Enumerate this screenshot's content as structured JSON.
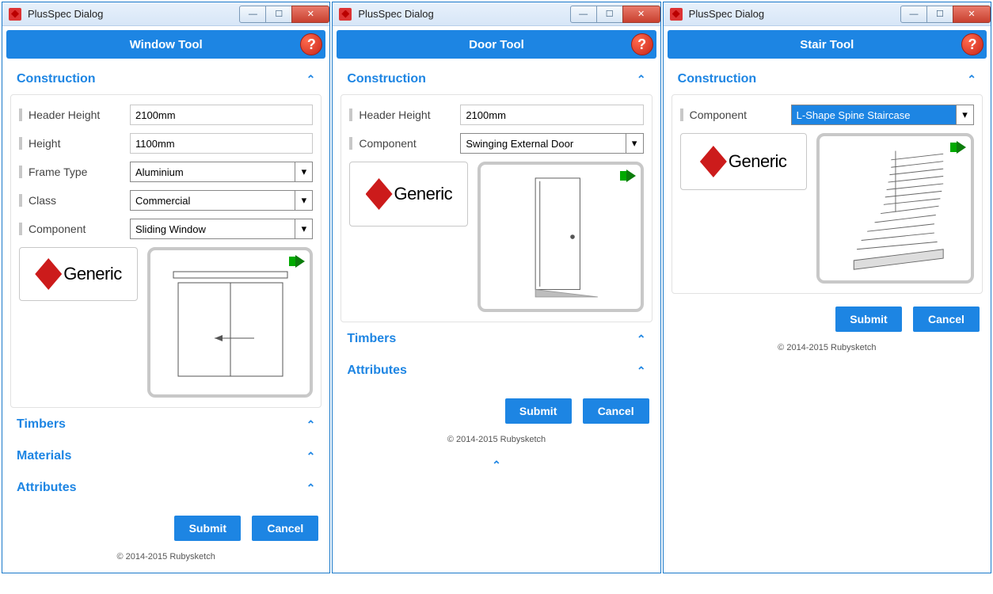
{
  "app_title": "PlusSpec Dialog",
  "help_symbol": "?",
  "brand_text": "Generic",
  "buttons": {
    "submit": "Submit",
    "cancel": "Cancel"
  },
  "copyright": "© 2014-2015 Rubysketch",
  "dialogs": {
    "window": {
      "title": "Window Tool",
      "sections": {
        "construction": "Construction",
        "timbers": "Timbers",
        "materials": "Materials",
        "attributes": "Attributes"
      },
      "fields": {
        "header_height": {
          "label": "Header Height",
          "value": "2100mm"
        },
        "height": {
          "label": "Height",
          "value": "1100mm"
        },
        "frame_type": {
          "label": "Frame Type",
          "value": "Aluminium"
        },
        "class": {
          "label": "Class",
          "value": "Commercial"
        },
        "component": {
          "label": "Component",
          "value": "Sliding Window"
        }
      }
    },
    "door": {
      "title": "Door Tool",
      "sections": {
        "construction": "Construction",
        "timbers": "Timbers",
        "attributes": "Attributes"
      },
      "fields": {
        "header_height": {
          "label": "Header Height",
          "value": "2100mm"
        },
        "component": {
          "label": "Component",
          "value": "Swinging External Door"
        }
      }
    },
    "stair": {
      "title": "Stair Tool",
      "sections": {
        "construction": "Construction"
      },
      "fields": {
        "component": {
          "label": "Component",
          "value": "L-Shape Spine Staircase"
        }
      }
    }
  }
}
